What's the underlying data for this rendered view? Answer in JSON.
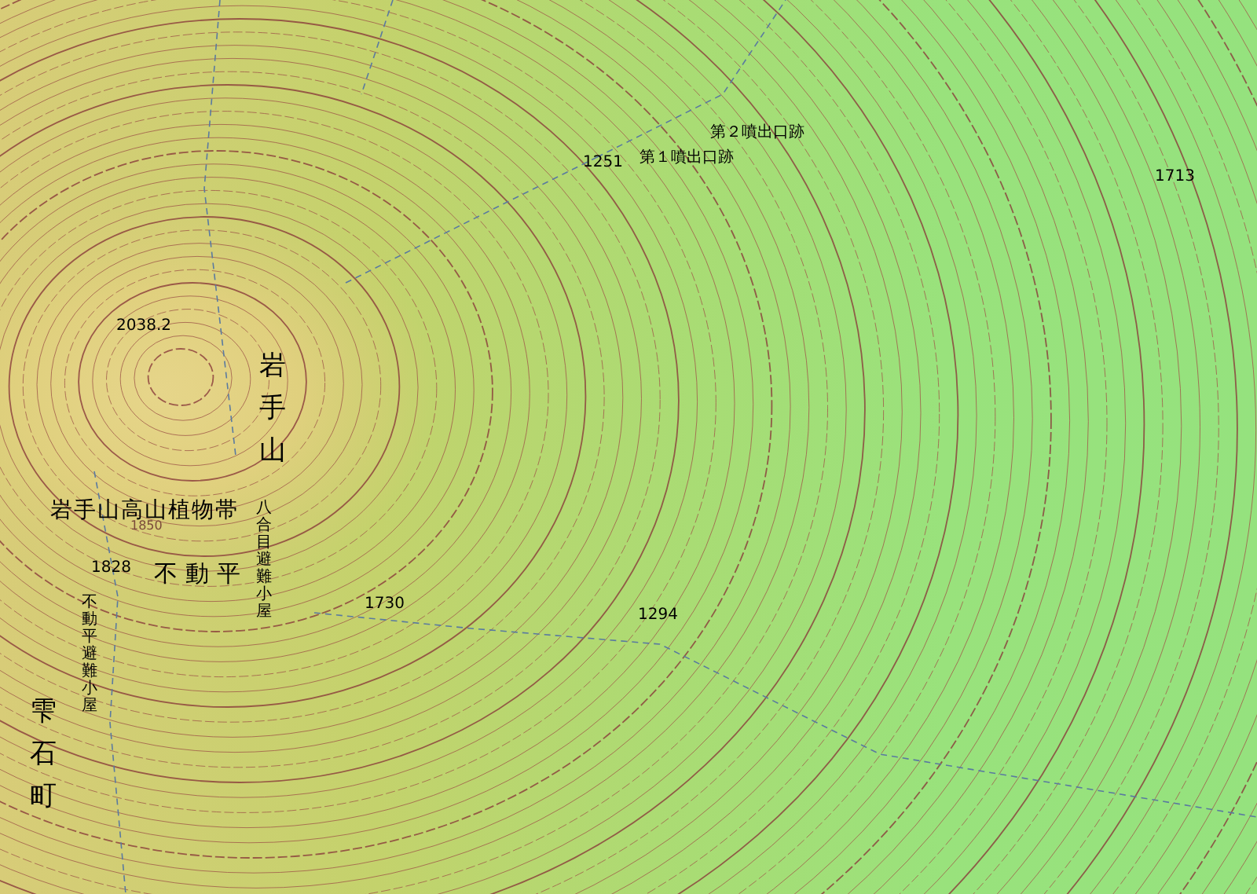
{
  "map": {
    "labels": [
      {
        "text": "第２噴出口跡",
        "kind": "place"
      },
      {
        "text": "第１噴出口跡",
        "kind": "place"
      },
      {
        "text": "1251",
        "kind": "elevation"
      },
      {
        "text": "1713",
        "kind": "elevation"
      },
      {
        "text": "2038.2",
        "kind": "elevation"
      },
      {
        "text": "岩手山",
        "kind": "vertical_large"
      },
      {
        "text": "岩手山高山植物帯",
        "kind": "area"
      },
      {
        "text": "1850",
        "kind": "contour"
      },
      {
        "text": "八合目避難小屋",
        "kind": "vertical"
      },
      {
        "text": "1828",
        "kind": "elevation"
      },
      {
        "text": "不動平",
        "kind": "area_wide"
      },
      {
        "text": "不動平避難小屋",
        "kind": "vertical"
      },
      {
        "text": "1730",
        "kind": "elevation"
      },
      {
        "text": "1294",
        "kind": "elevation"
      },
      {
        "text": "雫石町",
        "kind": "vertical_large"
      }
    ]
  }
}
